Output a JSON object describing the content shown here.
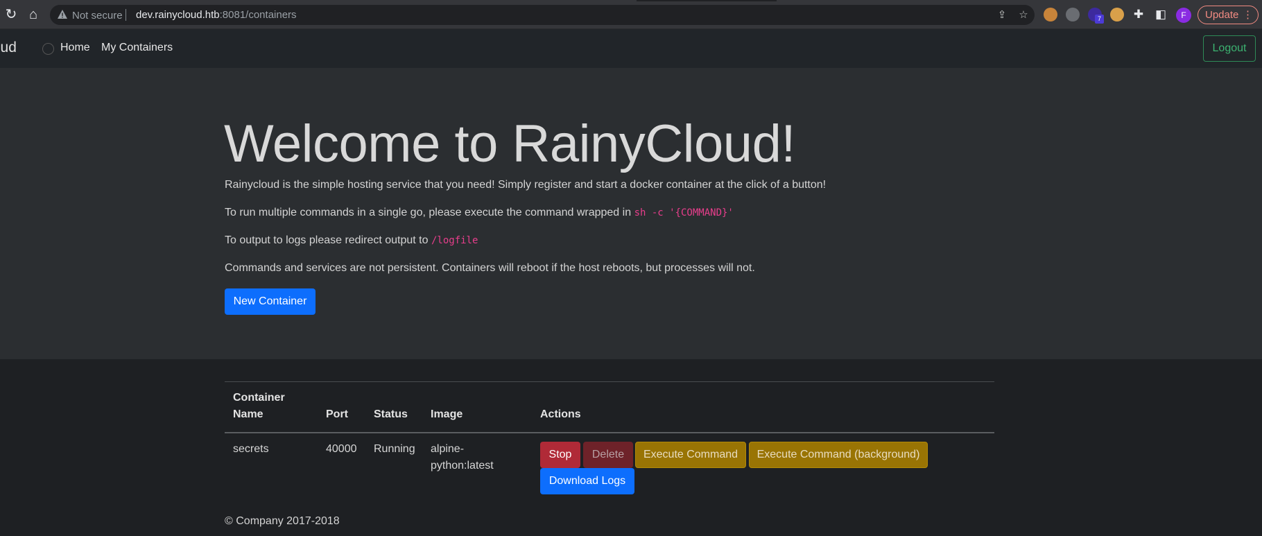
{
  "browser": {
    "security_label": "Not secure",
    "url_host": "dev.rainycloud.htb",
    "url_rest": ":8081/containers",
    "profile_initial": "F",
    "update_label": "Update",
    "ext_badge": "7"
  },
  "navbar": {
    "brand": "Cloud",
    "links": [
      "Home",
      "My Containers"
    ],
    "logout": "Logout"
  },
  "hero": {
    "title": "Welcome to RainyCloud!",
    "para1": "Rainycloud is the simple hosting service that you need! Simply register and start a docker container at the click of a button!",
    "para2_text": "To run multiple commands in a single go, please execute the command wrapped in",
    "para2_code": "sh -c '{COMMAND}'",
    "para3_text": "To output to logs please redirect output to",
    "para3_code": "/logfile",
    "para4": "Commands and services are not persistent. Containers will reboot if the host reboots, but processes will not.",
    "new_container": "New Container"
  },
  "table": {
    "headers": {
      "name_line1": "Container",
      "name_line2": "Name",
      "port": "Port",
      "status": "Status",
      "image": "Image",
      "actions": "Actions"
    },
    "rows": [
      {
        "name": "secrets",
        "port": "40000",
        "status": "Running",
        "image_line1": "alpine-",
        "image_line2": "python:latest"
      }
    ],
    "actions": {
      "stop": "Stop",
      "delete": "Delete",
      "execute": "Execute Command",
      "execute_bg": "Execute Command (background)",
      "download_logs": "Download Logs"
    }
  },
  "footer": "© Company 2017-2018",
  "colors": {
    "primary": "#0d6efd",
    "danger": "#b02a37",
    "warning": "#997404",
    "success": "#3cb371",
    "code": "#e83e8c"
  }
}
